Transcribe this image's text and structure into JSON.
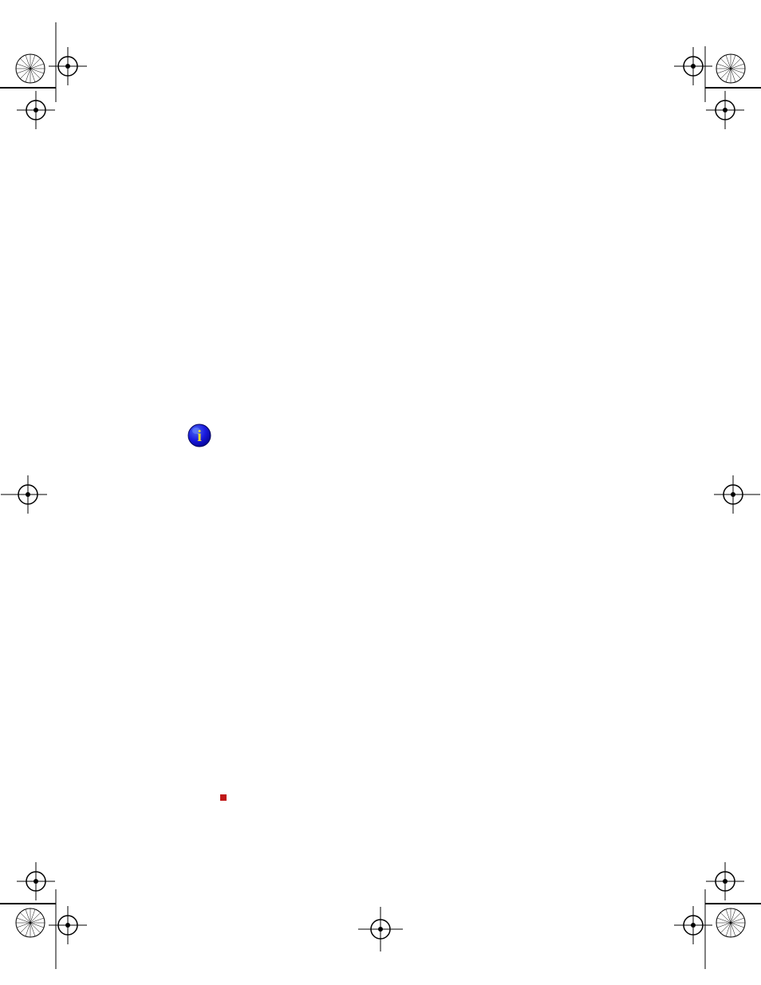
{
  "icons": {
    "info": "info-icon",
    "red_marker": "red-square-marker",
    "registration_mark": "registration-mark"
  }
}
